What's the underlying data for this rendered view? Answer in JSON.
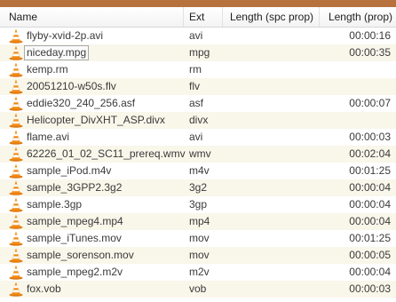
{
  "columns": {
    "name": "Name",
    "ext": "Ext",
    "length_spc": "Length (spc prop)",
    "length": "Length (prop)"
  },
  "selected_index": 1,
  "icon": "vlc-cone-icon",
  "colors": {
    "accent_bar": "#b8723e",
    "alt_row": "#f9f6ea",
    "cone_orange": "#f08a12"
  },
  "files": [
    {
      "name": "flyby-xvid-2p.avi",
      "ext": "avi",
      "length_spc": "",
      "length": "00:00:16"
    },
    {
      "name": "niceday.mpg",
      "ext": "mpg",
      "length_spc": "",
      "length": "00:00:35"
    },
    {
      "name": "kemp.rm",
      "ext": "rm",
      "length_spc": "",
      "length": ""
    },
    {
      "name": "20051210-w50s.flv",
      "ext": "flv",
      "length_spc": "",
      "length": ""
    },
    {
      "name": "eddie320_240_256.asf",
      "ext": "asf",
      "length_spc": "",
      "length": "00:00:07"
    },
    {
      "name": "Helicopter_DivXHT_ASP.divx",
      "ext": "divx",
      "length_spc": "",
      "length": ""
    },
    {
      "name": "flame.avi",
      "ext": "avi",
      "length_spc": "",
      "length": "00:00:03"
    },
    {
      "name": "62226_01_02_SC11_prereq.wmv",
      "ext": "wmv",
      "length_spc": "",
      "length": "00:02:04"
    },
    {
      "name": "sample_iPod.m4v",
      "ext": "m4v",
      "length_spc": "",
      "length": "00:01:25"
    },
    {
      "name": "sample_3GPP2.3g2",
      "ext": "3g2",
      "length_spc": "",
      "length": "00:00:04"
    },
    {
      "name": "sample.3gp",
      "ext": "3gp",
      "length_spc": "",
      "length": "00:00:04"
    },
    {
      "name": "sample_mpeg4.mp4",
      "ext": "mp4",
      "length_spc": "",
      "length": "00:00:04"
    },
    {
      "name": "sample_iTunes.mov",
      "ext": "mov",
      "length_spc": "",
      "length": "00:01:25"
    },
    {
      "name": "sample_sorenson.mov",
      "ext": "mov",
      "length_spc": "",
      "length": "00:00:05"
    },
    {
      "name": "sample_mpeg2.m2v",
      "ext": "m2v",
      "length_spc": "",
      "length": "00:00:04"
    },
    {
      "name": "fox.vob",
      "ext": "vob",
      "length_spc": "",
      "length": "00:00:03"
    }
  ]
}
